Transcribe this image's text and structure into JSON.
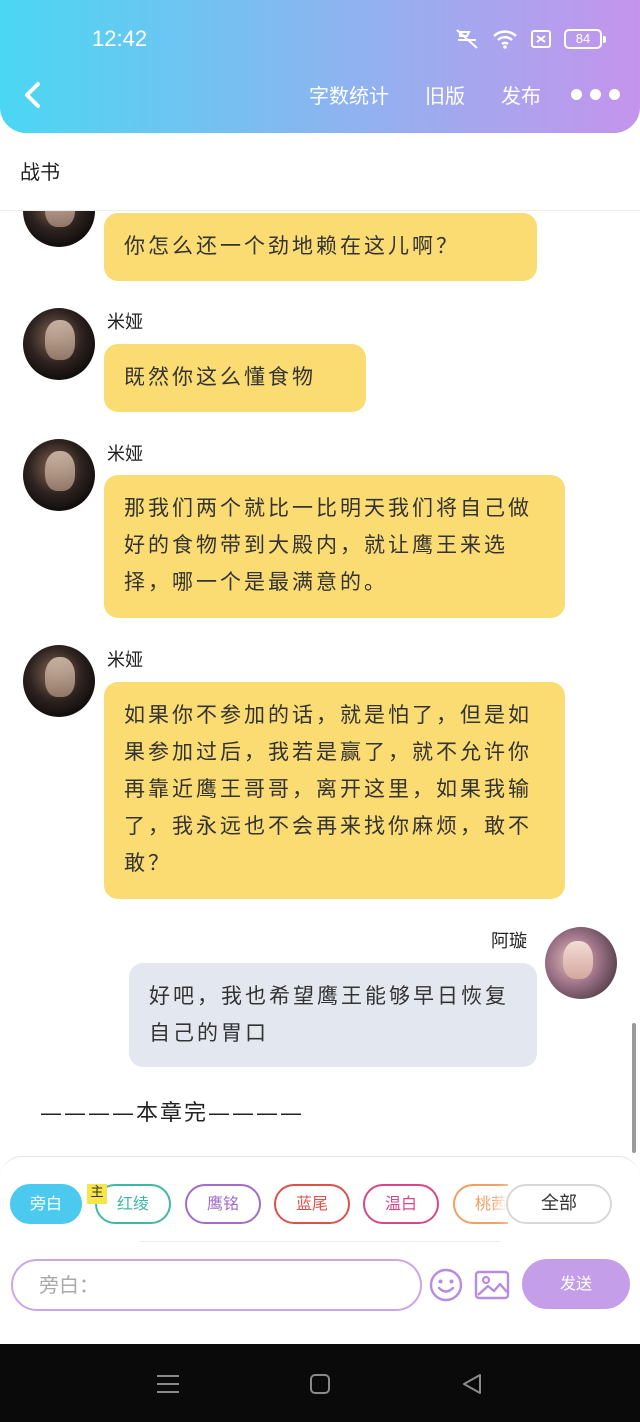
{
  "status_bar": {
    "time": "12:42",
    "battery": "84"
  },
  "header": {
    "actions": [
      "字数统计",
      "旧版",
      "发布"
    ]
  },
  "document": {
    "title": "战书"
  },
  "messages": [
    {
      "side": "left",
      "speaker": "",
      "text": "你怎么还一个劲地赖在这儿啊？"
    },
    {
      "side": "left",
      "speaker": "米娅",
      "text": "既然你这么懂食物"
    },
    {
      "side": "left",
      "speaker": "米娅",
      "text": "那我们两个就比一比明天我们将自己做好的食物带到大殿内，就让鹰王来选择，哪一个是最满意的。"
    },
    {
      "side": "left",
      "speaker": "米娅",
      "text": "如果你不参加的话，就是怕了，但是如果参加过后，我若是赢了，就不允许你再靠近鹰王哥哥，离开这里，如果我输了，我永远也不会再来找你麻烦，敢不敢？"
    },
    {
      "side": "right",
      "speaker": "阿璇",
      "text": "好吧，我也希望鹰王能够早日恢复自己的胃口"
    }
  ],
  "chapter_end": "————本章完————",
  "composer": {
    "main_tag": "主",
    "characters": [
      {
        "label": "旁白",
        "color": "#4cc9ee",
        "active": true
      },
      {
        "label": "红绫",
        "color": "#3fb9a3",
        "active": false
      },
      {
        "label": "鹰铭",
        "color": "#a26cc9",
        "active": false
      },
      {
        "label": "蓝尾",
        "color": "#d9534a",
        "active": false
      },
      {
        "label": "温白",
        "color": "#d9478a",
        "active": false
      },
      {
        "label": "桃茜",
        "color": "#f0a062",
        "active": false
      }
    ],
    "all_label": "全部",
    "input_placeholder": "旁白：",
    "send_label": "发送",
    "emoji_icon": "emoji-icon",
    "image_icon": "image-icon"
  }
}
